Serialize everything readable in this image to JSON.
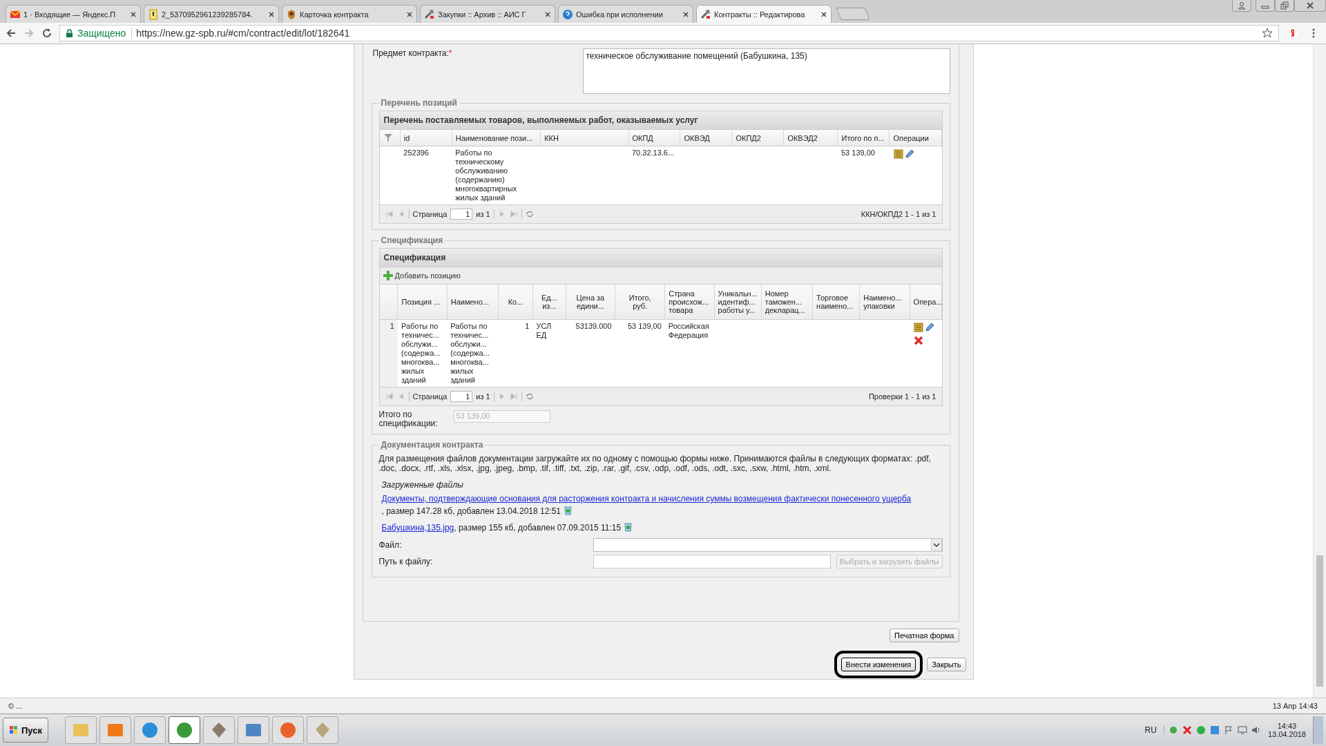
{
  "browser": {
    "tabs": [
      {
        "title": "1 · Входящие — Яндекс.П",
        "kind": "mail",
        "selected": false
      },
      {
        "title": "2_5370952961239285784.",
        "kind": "note",
        "selected": false
      },
      {
        "title": "Карточка контракта",
        "kind": "emblem",
        "selected": false
      },
      {
        "title": "Закупки :: Архив :: АИС Г",
        "kind": "tool",
        "selected": false
      },
      {
        "title": "Ошибка при исполнении",
        "kind": "help",
        "selected": false
      },
      {
        "title": "Контракты :: Редактирова",
        "kind": "tool",
        "selected": true
      }
    ],
    "security_label": "Защищено",
    "url": "https://new.gz-spb.ru/#cm/contract/edit/lot/182641"
  },
  "subject": {
    "label": "Предмет контракта:",
    "required_mark": "*",
    "value": "техническое обслуживание помещений (Бабушкина, 135)"
  },
  "positions": {
    "legend": "Перечень позиций",
    "title": "Перечень поставляемых товаров, выполняемых работ, оказываемых услуг",
    "columns": [
      "id",
      "Наименование пози...",
      "ККН",
      "ОКПД",
      "ОКВЭД",
      "ОКПД2",
      "ОКВЭД2",
      "Итого по п...",
      "Операции"
    ],
    "rows": [
      {
        "cells": [
          "252396",
          "Работы по\nтехническому\nобслуживанию\n(содержанию)\nмногоквартирных\nжилых зданий",
          null,
          "70.32.13.6...",
          null,
          null,
          null,
          "53 139,00"
        ]
      }
    ],
    "pager": {
      "page_label": "Страница",
      "page": "1",
      "of": "из 1",
      "summary": "ККН/ОКПД2 1 - 1 из 1"
    }
  },
  "specification": {
    "legend": "Спецификация",
    "title": "Спецификация",
    "add_button": "Добавить позицию",
    "columns": [
      "Позиция ...",
      "Наимено...",
      "Ко...",
      "Ед...\nиз...",
      "Цена за\nедини...",
      "Итого,\nруб.",
      "Страна\nпроисхож...\nтовара",
      "Уникальн...\nидентиф...\nработы у...",
      "Номер\nтаможен...\nдекларац...",
      "Торговое\nнаимено...",
      "Наимено...\nупаковки",
      "Опера..."
    ],
    "rows": [
      {
        "number": "1",
        "cells": [
          "Работы по\nтехничес...\nобслужи...\n(содержа...\nмногоква...\nжилых\nзданий",
          "Работы по\nтехничес...\nобслужи...\n(содержа...\nмногоква...\nжилых\nзданий",
          "1",
          "УСЛ ЕД",
          "53139.000",
          "53 139,00",
          "Российская\nФедерация",
          null,
          null,
          null,
          null
        ]
      }
    ],
    "pager": {
      "page_label": "Страница",
      "page": "1",
      "of": "из 1",
      "summary": "Проверки 1 - 1 из 1"
    },
    "total_label": "Итого по\nспецификации:",
    "total_value": "53 139,00"
  },
  "documents": {
    "legend": "Документация контракта",
    "note": "Для размещения файлов документации загружайте их по одному с помощью формы ниже. Принимаются файлы в следующих форматах: .pdf, .doc, .docx, .rtf, .xls, .xlsx, .jpg, .jpeg, .bmp, .tif, .tiff, .txt, .zip, .rar, .gif, .csv, .odp, .odf, .ods, .odt, .sxc, .sxw, .html, .htm, .xml.",
    "uploaded_heading": "Загруженные файлы",
    "files": [
      {
        "link": "Документы, подтверждающие основания для расторжения контракта и начисления суммы возмещения фактически понесенного ущерба",
        "details": ", размер 147.28 кб, добавлен 13.04.2018 12:51"
      },
      {
        "link": "Бабушкина,135.jpg",
        "details": ", размер 155 кб, добавлен 07.09.2015 11:15"
      }
    ],
    "file_label": "Файл:",
    "path_label": "Путь к файлу:",
    "upload_button": "Выбрать и загрузить файлы"
  },
  "print_button": "Печатная форма",
  "buttons": [
    {
      "label": "Внести изменения",
      "focused": true
    },
    {
      "label": "Закрыть",
      "focused": false
    }
  ],
  "status_bar": {
    "left": "© ...",
    "right": "13 Апр 14:43"
  },
  "taskbar": {
    "start": "Пуск",
    "apps": [
      {
        "kind": "folder",
        "selected": false
      },
      {
        "kind": "pdf",
        "selected": false
      },
      {
        "kind": "ie",
        "selected": false
      },
      {
        "kind": "chrome",
        "selected": true
      },
      {
        "kind": "person",
        "selected": false
      },
      {
        "kind": "photo",
        "selected": false
      },
      {
        "kind": "firefox",
        "selected": false
      },
      {
        "kind": "paint",
        "selected": false
      }
    ],
    "language": "RU",
    "time": "14:43",
    "date": "13.04.2018"
  }
}
